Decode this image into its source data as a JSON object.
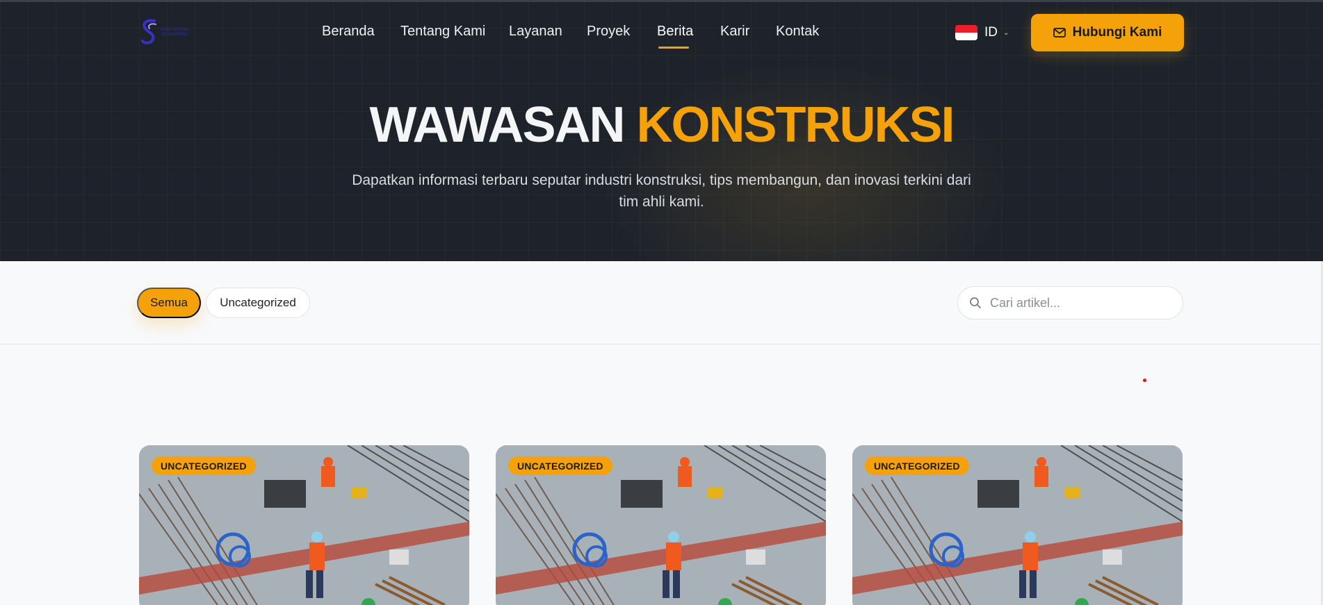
{
  "header": {
    "logo_alt": "logo",
    "logo_lines": [
      "BALI AGUNG",
      "SEJAHTERA"
    ],
    "nav": [
      {
        "label": "Beranda"
      },
      {
        "label": "Tentang Kami"
      },
      {
        "label": "Layanan"
      },
      {
        "label": "Proyek"
      },
      {
        "label": "Berita"
      },
      {
        "label": "Karir"
      },
      {
        "label": "Kontak"
      }
    ],
    "active_nav": "Berita",
    "language": {
      "code": "ID",
      "flag": "indonesia-flag"
    },
    "cta_label": "Hubungi Kami",
    "cta_icon": "mail-icon"
  },
  "hero": {
    "title_white": "WAWASAN",
    "title_orange": "KONSTRUKSI",
    "subtitle": "Dapatkan informasi terbaru seputar industri konstruksi, tips membangun, dan inovasi terkini dari tim ahli kami."
  },
  "filters": {
    "categories": [
      {
        "label": "Semua",
        "active": true
      },
      {
        "label": "Uncategorized",
        "active": false
      }
    ],
    "search_placeholder": "Cari artikel...",
    "search_icon": "search-icon"
  },
  "articles": [
    {
      "category": "UNCATEGORIZED",
      "image": "construction-workers-photo"
    },
    {
      "category": "UNCATEGORIZED",
      "image": "construction-workers-photo"
    },
    {
      "category": "UNCATEGORIZED",
      "image": "construction-workers-photo"
    }
  ],
  "colors": {
    "accent": "#f5a10a",
    "hero_bg": "#1e232b",
    "page_bg": "#f8f9fb"
  }
}
